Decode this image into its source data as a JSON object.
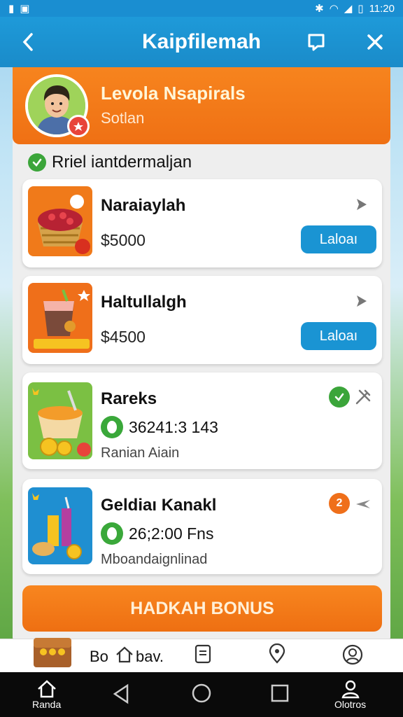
{
  "status_bar": {
    "time": "11:20"
  },
  "app_bar": {
    "title": "Kaipfilemah"
  },
  "profile": {
    "name": "Levola Nsapirals",
    "subtitle": "Sotlan"
  },
  "section": {
    "title": "Rriel iantdermaljan"
  },
  "items": [
    {
      "name": "Naraiaylah",
      "price": "$5000",
      "button": "Laloaı"
    },
    {
      "name": "Haltullalgh",
      "price": "$4500",
      "button": "Laloaı"
    },
    {
      "name": "Rareks",
      "points": "36241:3 143",
      "desc": "Ranian Aiain",
      "status": "check"
    },
    {
      "name": "Geldiaı Kanakl",
      "points": "26;2:00 Fns",
      "desc": "Mboandaignlinad",
      "status": "2"
    }
  ],
  "bonus_button": "HADKAH BONUS",
  "tab_bar": {
    "middle_label": "Bo",
    "middle_label_2": "bav."
  },
  "nav_bar": {
    "home": "Randa",
    "profile": "Olotros"
  },
  "colors": {
    "primary_blue": "#1a8ed1",
    "accent_orange": "#f07a1a",
    "check_green": "#3ba53a",
    "badge_orange": "#ef6f1a"
  }
}
